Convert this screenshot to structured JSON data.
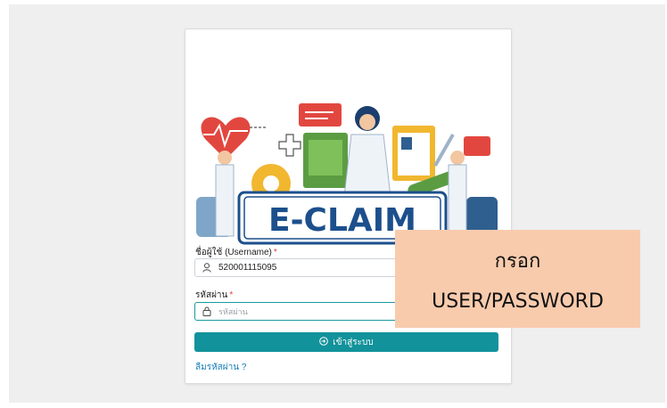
{
  "brand": {
    "logo_text": "E-CLAIM"
  },
  "form": {
    "username_label": "ชื่อผู้ใช้ (Username)",
    "username_value": "520001115095",
    "password_label": "รหัสผ่าน",
    "password_placeholder": "รหัสผ่าน",
    "required_mark": "*",
    "login_button": "เข้าสู่ระบบ",
    "forgot_link": "ลืมรหัสผ่าน ?"
  },
  "callout": {
    "line1": "กรอก",
    "line2": "USER/PASSWORD"
  },
  "colors": {
    "primary": "#12929b",
    "callout_bg": "#f8cbad",
    "required": "#e0453a",
    "logo_blue": "#1c4f8c"
  },
  "icons": [
    "user-icon",
    "lock-icon",
    "login-icon"
  ]
}
